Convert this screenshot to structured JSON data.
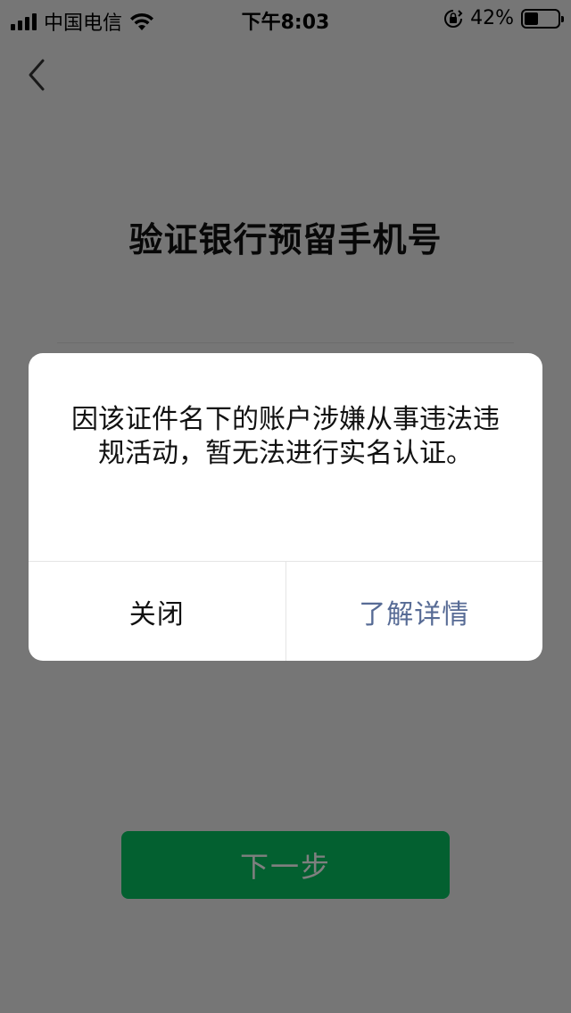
{
  "status_bar": {
    "carrier": "中国电信",
    "time": "下午8:03",
    "battery": "42%",
    "battery_level": 0.42
  },
  "page": {
    "back_icon": "chevron-left-icon",
    "title": "验证银行预留手机号",
    "next_button": "下一步",
    "accent_color": "#07c160"
  },
  "dialog": {
    "message": "因该证件名下的账户涉嫌从事违法违规活动，暂无法进行实名认证。",
    "close_label": "关闭",
    "details_label": "了解详情",
    "details_color": "#576b95"
  }
}
